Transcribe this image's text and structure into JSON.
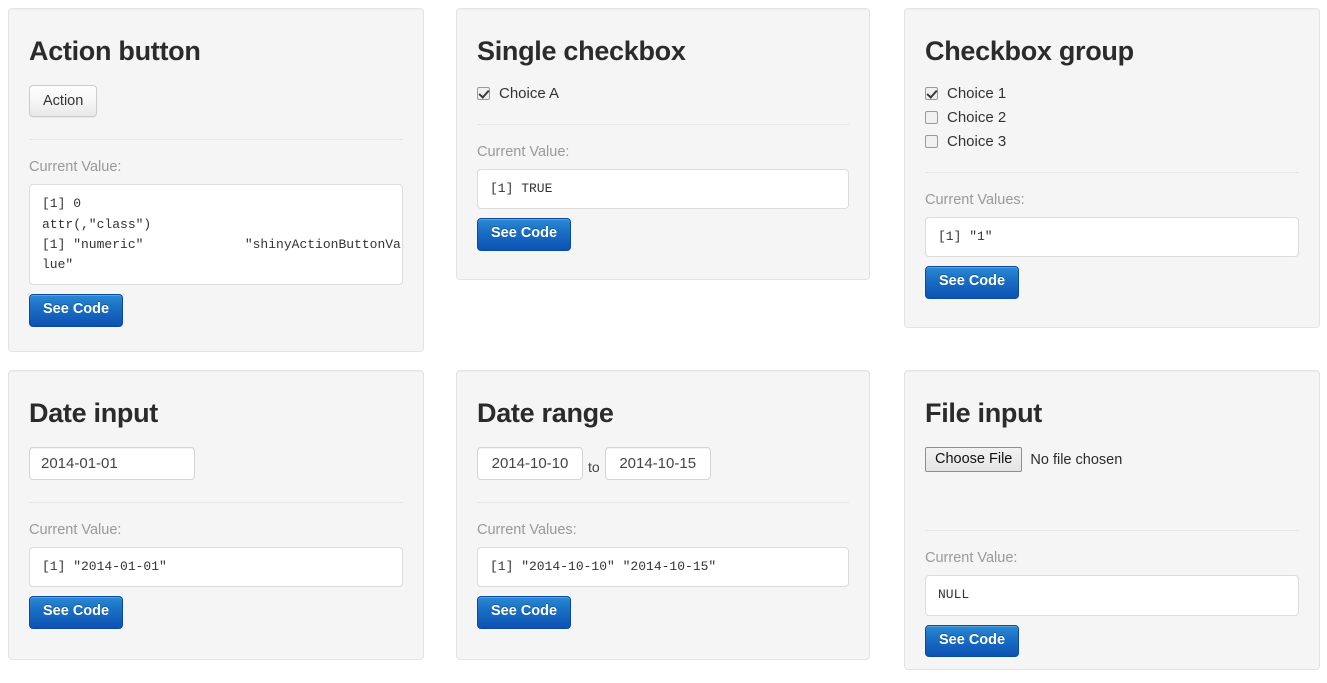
{
  "panels": {
    "action_button": {
      "title": "Action button",
      "button_label": "Action",
      "value_label": "Current Value:",
      "output": "[1] 0\nattr(,\"class\")\n[1] \"numeric\"             \"shinyActionButtonVa\nlue\"",
      "see_code_label": "See Code"
    },
    "single_checkbox": {
      "title": "Single checkbox",
      "choice_label": "Choice A",
      "checked": true,
      "value_label": "Current Value:",
      "output": "[1] TRUE",
      "see_code_label": "See Code"
    },
    "checkbox_group": {
      "title": "Checkbox group",
      "choices": [
        {
          "label": "Choice 1",
          "checked": true
        },
        {
          "label": "Choice 2",
          "checked": false
        },
        {
          "label": "Choice 3",
          "checked": false
        }
      ],
      "value_label": "Current Values:",
      "output": "[1] \"1\"",
      "see_code_label": "See Code"
    },
    "date_input": {
      "title": "Date input",
      "date_value": "2014-01-01",
      "value_label": "Current Value:",
      "output": "[1] \"2014-01-01\"",
      "see_code_label": "See Code"
    },
    "date_range": {
      "title": "Date range",
      "start_value": "2014-10-10",
      "separator": "to",
      "end_value": "2014-10-15",
      "value_label": "Current Values:",
      "output": "[1] \"2014-10-10\" \"2014-10-15\"",
      "see_code_label": "See Code"
    },
    "file_input": {
      "title": "File input",
      "choose_label": "Choose File",
      "no_file_label": "No file chosen",
      "value_label": "Current Value:",
      "output": "NULL",
      "see_code_label": "See Code"
    }
  },
  "colors": {
    "panel_bg": "#f5f5f5",
    "panel_border": "#e3e3e3",
    "accent_blue": "#0d52b5",
    "label_gray": "#999999"
  }
}
